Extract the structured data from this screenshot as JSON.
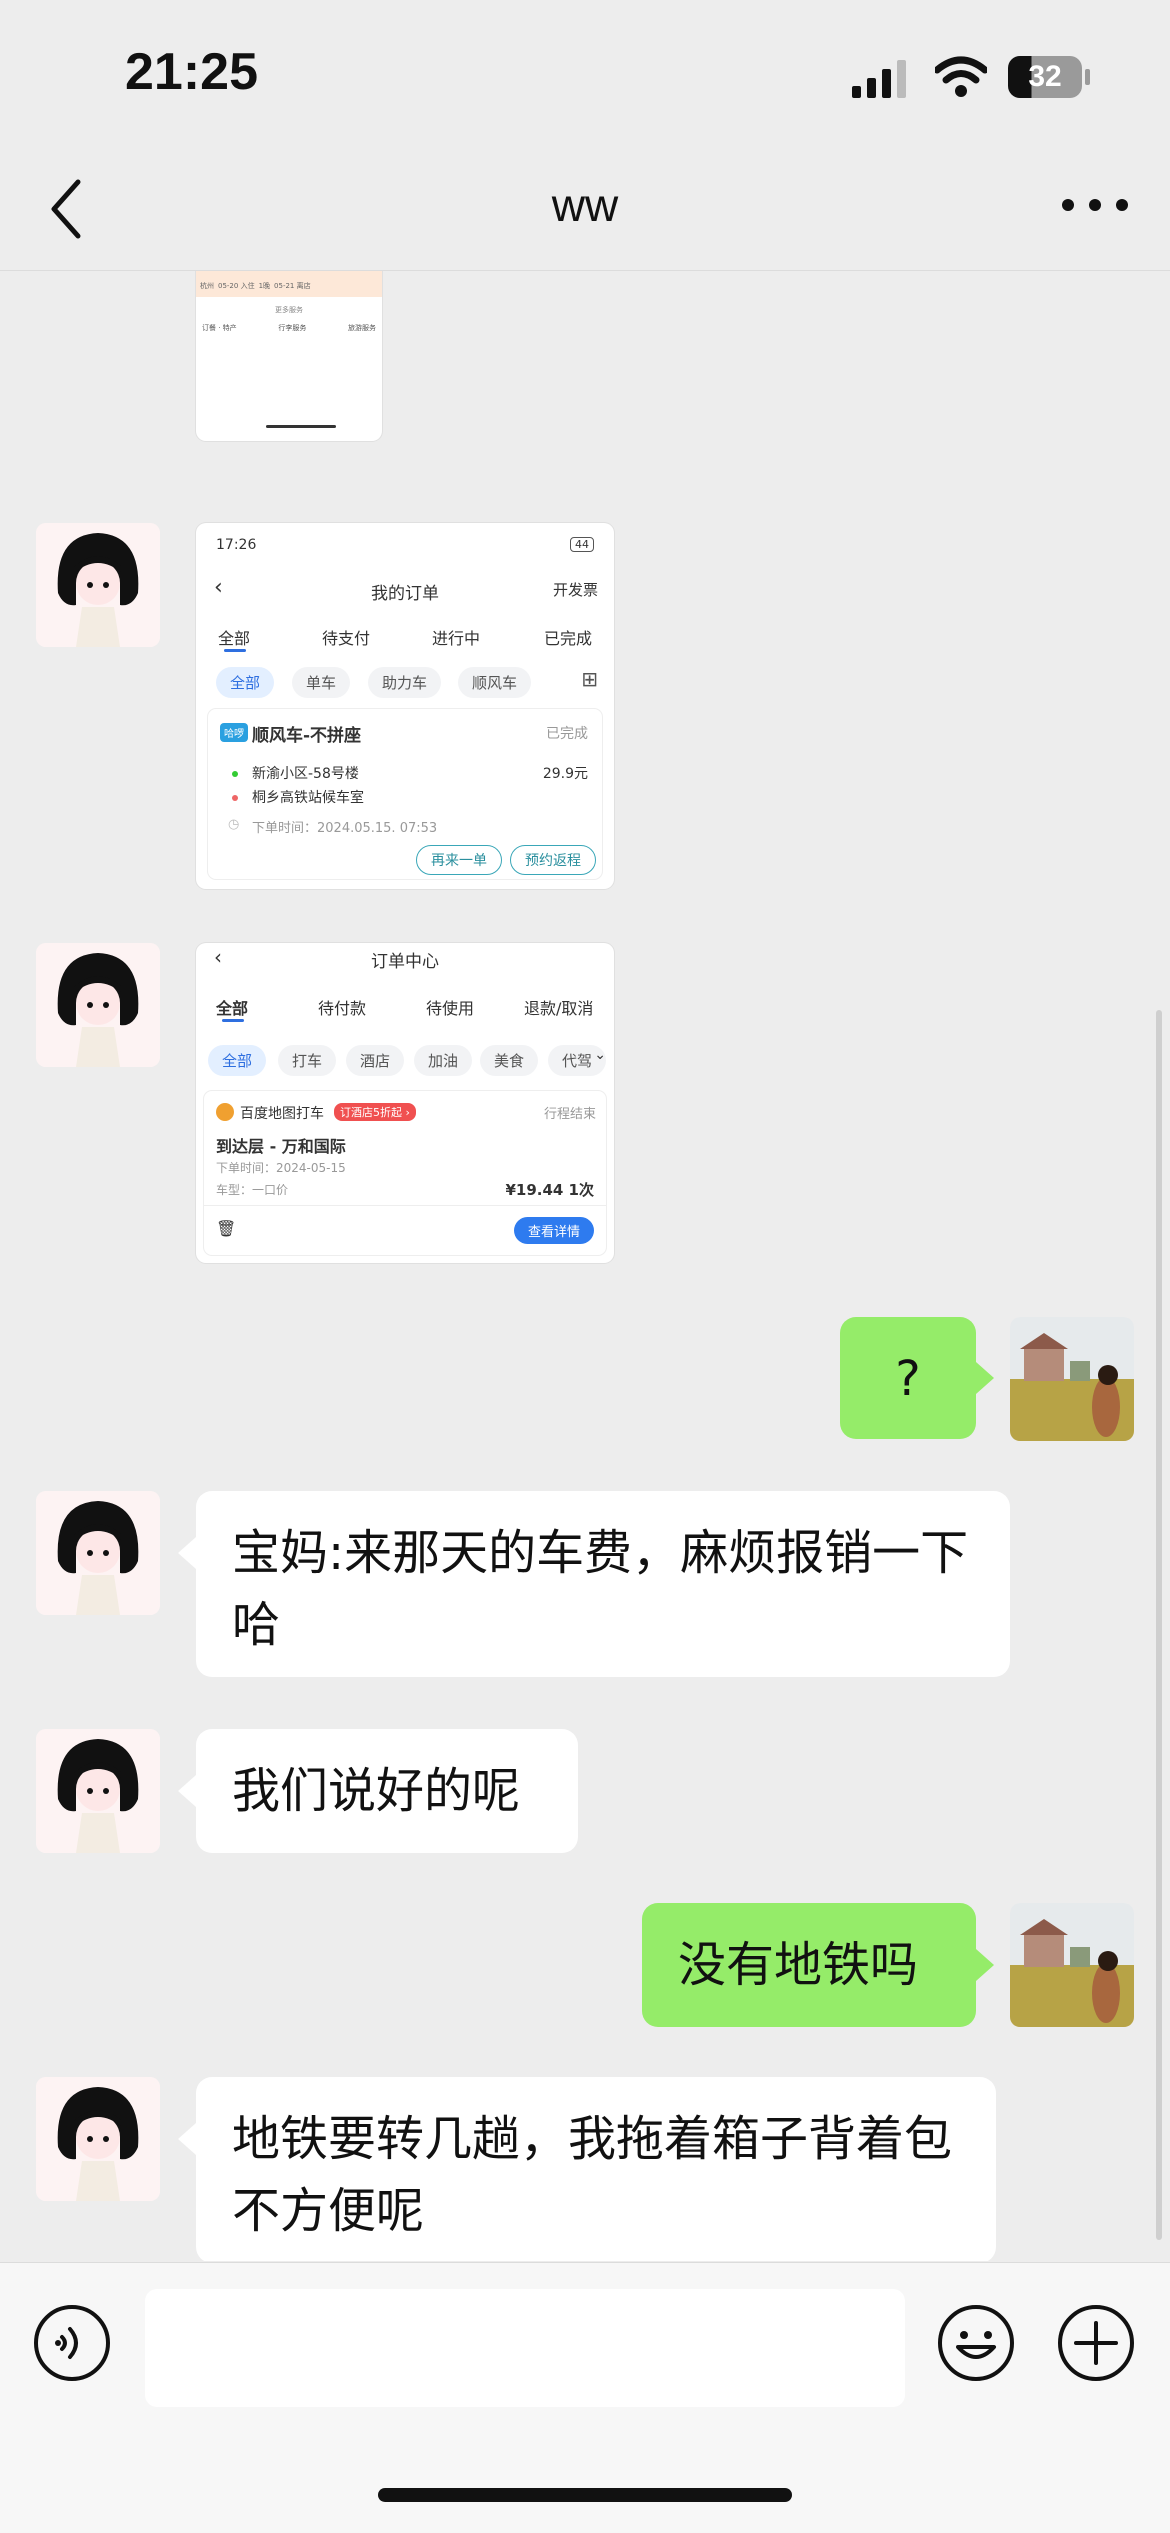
{
  "status_bar": {
    "time": "21:25",
    "battery": "32"
  },
  "header": {
    "title": "ww"
  },
  "messages": [
    {
      "side": "left",
      "type": "screenshot",
      "screenshot": "didi-order-list"
    },
    {
      "side": "left",
      "type": "screenshot",
      "screenshot": "baidu-order-center"
    },
    {
      "side": "right",
      "type": "text",
      "text": "?"
    },
    {
      "side": "left",
      "type": "text",
      "text": "宝妈:来那天的车费，麻烦报销一下哈"
    },
    {
      "side": "left",
      "type": "text",
      "text": "我们说好的呢"
    },
    {
      "side": "right",
      "type": "text",
      "text": "没有地铁吗"
    },
    {
      "side": "left",
      "type": "text",
      "text": "地铁要转几趟，我拖着箱子背着包不方便呢"
    }
  ],
  "top_partial_shot": {
    "row1": [
      "杭州",
      "05-20 入住",
      "1晚",
      "05-21 离店"
    ],
    "more": "更多服务",
    "services": [
      "订餐 · 特产",
      "行李服务",
      "旅游服务"
    ]
  },
  "shot1": {
    "time": "17:26",
    "battery": "44",
    "title": "我的订单",
    "right_action": "开发票",
    "tabs": [
      "全部",
      "待支付",
      "进行中",
      "已完成"
    ],
    "chips": [
      "全部",
      "单车",
      "助力车",
      "顺风车"
    ],
    "badge": "哈啰",
    "order_title": "顺风车-不拼座",
    "order_status": "已完成",
    "from": "新渝小区-58号楼",
    "to": "桐乡高铁站候车室",
    "price": "29.9元",
    "order_time": "下单时间：2024.05.15. 07:53",
    "btn1": "再来一单",
    "btn2": "预约返程"
  },
  "shot2": {
    "title": "订单中心",
    "tabs": [
      "全部",
      "待付款",
      "待使用",
      "退款/取消"
    ],
    "chips": [
      "全部",
      "打车",
      "酒店",
      "加油",
      "美食",
      "代驾"
    ],
    "brand": "百度地图打车",
    "promo": "订酒店5折起 ›",
    "status": "行程结束",
    "destination": "到达层 - 万和国际",
    "order_date": "下单时间：2024-05-15",
    "car_type": "车型：一口价",
    "price": "¥19.44 1次",
    "detail_btn": "查看详情"
  },
  "colors": {
    "bg": "#ededed",
    "self_bubble": "#95ec69",
    "other_bubble": "#ffffff"
  }
}
